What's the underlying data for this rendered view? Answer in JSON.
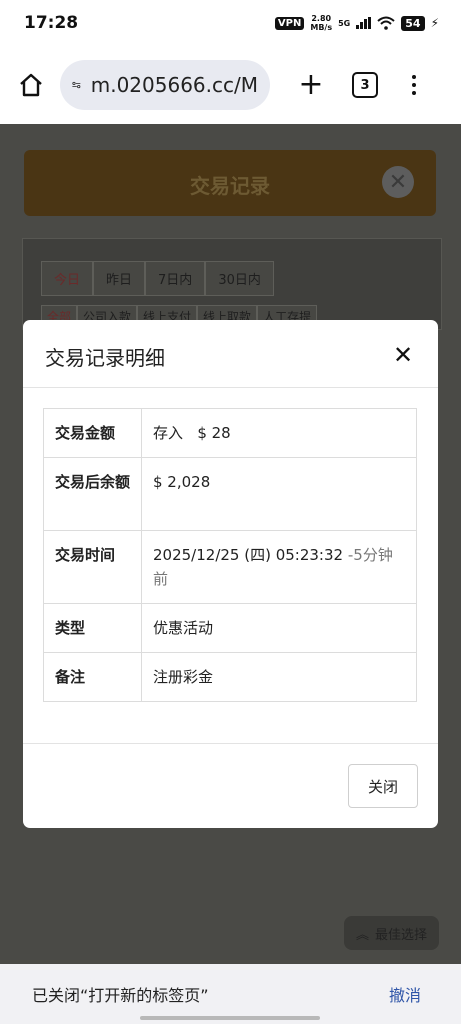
{
  "status_bar": {
    "time": "17:28",
    "vpn": "VPN",
    "speed_value": "2.80",
    "speed_unit": "MB/s",
    "network": "5G",
    "battery": "54"
  },
  "browser": {
    "url": "m.0205666.cc/M",
    "tab_count": "3"
  },
  "background_page": {
    "title": "交易记录",
    "date_tabs": [
      "今日",
      "昨日",
      "7日内",
      "30日内"
    ],
    "type_tabs": [
      "全部",
      "公司入款",
      "线上支付",
      "线上取款",
      "人工存提"
    ],
    "best_pick": "最佳选择"
  },
  "modal": {
    "title": "交易记录明细",
    "rows": {
      "amount": {
        "label": "交易金额",
        "type": "存入",
        "value": "$ 28"
      },
      "balance": {
        "label": "交易后余额",
        "value": "$ 2,028"
      },
      "time": {
        "label": "交易时间",
        "value": "2025/12/25 (四) 05:23:32",
        "relative": "-5分钟前"
      },
      "category": {
        "label": "类型",
        "value": "优惠活动"
      },
      "note": {
        "label": "备注",
        "value": "注册彩金"
      }
    },
    "close_button": "关闭"
  },
  "snackbar": {
    "message": "已关闭“打开新的标签页”",
    "action": "撤消"
  },
  "colors": {
    "positive": "#3a8d3a",
    "link": "#2f55a8"
  }
}
